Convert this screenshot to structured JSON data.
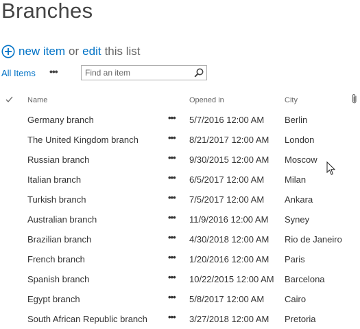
{
  "page": {
    "title": "Branches"
  },
  "actions": {
    "new_item": "new item",
    "or": "or",
    "edit": "edit",
    "this_list": "this list"
  },
  "views": {
    "current": "All Items",
    "more": "•••"
  },
  "search": {
    "placeholder": "Find an item"
  },
  "columns": {
    "name": "Name",
    "opened_in": "Opened in",
    "city": "City"
  },
  "row_menu": "•••",
  "rows": [
    {
      "name": "Germany branch",
      "opened_in": "5/7/2016 12:00 AM",
      "city": "Berlin"
    },
    {
      "name": "The United Kingdom branch",
      "opened_in": "8/21/2017 12:00 AM",
      "city": "London"
    },
    {
      "name": "Russian branch",
      "opened_in": "9/30/2015 12:00 AM",
      "city": "Moscow"
    },
    {
      "name": "Italian branch",
      "opened_in": "6/5/2017 12:00 AM",
      "city": "Milan"
    },
    {
      "name": "Turkish branch",
      "opened_in": "7/5/2017 12:00 AM",
      "city": "Ankara"
    },
    {
      "name": "Australian branch",
      "opened_in": "11/9/2016 12:00 AM",
      "city": "Syney"
    },
    {
      "name": "Brazilian branch",
      "opened_in": "4/30/2018 12:00 AM",
      "city": "Rio de Janeiro"
    },
    {
      "name": "French branch",
      "opened_in": "1/20/2016 12:00 AM",
      "city": "Paris"
    },
    {
      "name": "Spanish branch",
      "opened_in": "10/22/2015 12:00 AM",
      "city": "Barcelona"
    },
    {
      "name": "Egypt branch",
      "opened_in": "5/8/2017 12:00 AM",
      "city": "Cairo"
    },
    {
      "name": "South African Republic branch",
      "opened_in": "3/27/2018 12:00 AM",
      "city": "Pretoria"
    }
  ],
  "colors": {
    "link": "#0072c6",
    "text": "#333333",
    "muted": "#666666",
    "border": "#ababab"
  }
}
